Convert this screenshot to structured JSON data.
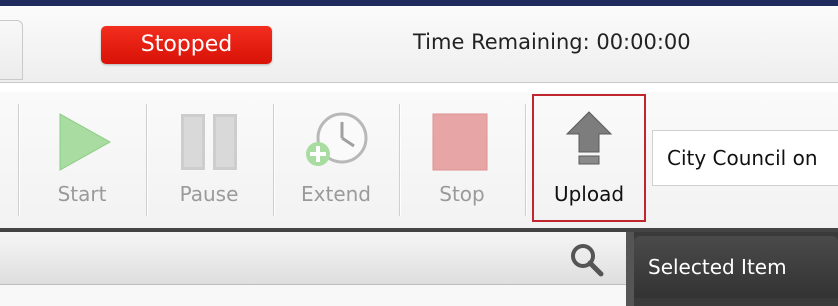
{
  "status_bar": {
    "status": "Stopped",
    "time_remaining": "Time Remaining: 00:00:00"
  },
  "toolbar": {
    "buttons": [
      {
        "label": "Start",
        "icon": "play-icon",
        "enabled": false
      },
      {
        "label": "Pause",
        "icon": "pause-icon",
        "enabled": false
      },
      {
        "label": "Extend",
        "icon": "clock-plus-icon",
        "enabled": false
      },
      {
        "label": "Stop",
        "icon": "stop-icon",
        "enabled": false
      },
      {
        "label": "Upload",
        "icon": "upload-arrow-icon",
        "enabled": true,
        "highlighted": true
      }
    ],
    "meeting_name": "City Council on"
  },
  "panes": {
    "right_header": "Selected Item"
  },
  "colors": {
    "status_red": "#e01a0f",
    "highlight_border": "#c0262d",
    "disabled_green": "#a8dca0",
    "disabled_red": "#e8a5a5"
  }
}
